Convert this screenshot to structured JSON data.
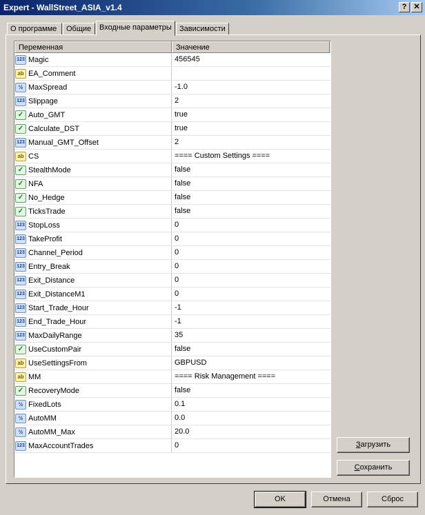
{
  "window": {
    "title": "Expert - WallStreet_ASIA_v1.4",
    "help_glyph": "?",
    "close_glyph": "✕"
  },
  "tabs": [
    {
      "label": "О программе"
    },
    {
      "label": "Общие"
    },
    {
      "label": "Входные параметры"
    },
    {
      "label": "Зависимости"
    }
  ],
  "grid": {
    "headers": {
      "variable": "Переменная",
      "value": "Значение"
    },
    "rows": [
      {
        "type": "int",
        "icon": "int-icon",
        "badge": "123",
        "name": "Magic",
        "value": "456545"
      },
      {
        "type": "str",
        "icon": "string-icon",
        "badge": "ab",
        "name": "EA_Comment",
        "value": ""
      },
      {
        "type": "dbl",
        "icon": "double-icon",
        "badge": "½",
        "name": "MaxSpread",
        "value": "-1.0"
      },
      {
        "type": "int",
        "icon": "int-icon",
        "badge": "123",
        "name": "Slippage",
        "value": "2"
      },
      {
        "type": "bool",
        "icon": "bool-icon",
        "badge": "✓",
        "name": "Auto_GMT",
        "value": "true"
      },
      {
        "type": "bool",
        "icon": "bool-icon",
        "badge": "✓",
        "name": "Calculate_DST",
        "value": "true"
      },
      {
        "type": "int",
        "icon": "int-icon",
        "badge": "123",
        "name": "Manual_GMT_Offset",
        "value": "2"
      },
      {
        "type": "str",
        "icon": "string-icon",
        "badge": "ab",
        "name": "CS",
        "value": "==== Custom Settings ===="
      },
      {
        "type": "bool",
        "icon": "bool-icon",
        "badge": "✓",
        "name": "StealthMode",
        "value": "false"
      },
      {
        "type": "bool",
        "icon": "bool-icon",
        "badge": "✓",
        "name": "NFA",
        "value": "false"
      },
      {
        "type": "bool",
        "icon": "bool-icon",
        "badge": "✓",
        "name": "No_Hedge",
        "value": "false"
      },
      {
        "type": "bool",
        "icon": "bool-icon",
        "badge": "✓",
        "name": "TicksTrade",
        "value": "false"
      },
      {
        "type": "int",
        "icon": "int-icon",
        "badge": "123",
        "name": "StopLoss",
        "value": "0"
      },
      {
        "type": "int",
        "icon": "int-icon",
        "badge": "123",
        "name": "TakeProfit",
        "value": "0"
      },
      {
        "type": "int",
        "icon": "int-icon",
        "badge": "123",
        "name": "Channel_Period",
        "value": "0"
      },
      {
        "type": "int",
        "icon": "int-icon",
        "badge": "123",
        "name": "Entry_Break",
        "value": "0"
      },
      {
        "type": "int",
        "icon": "int-icon",
        "badge": "123",
        "name": "Exit_Distance",
        "value": "0"
      },
      {
        "type": "int",
        "icon": "int-icon",
        "badge": "123",
        "name": "Exit_DistanceM1",
        "value": "0"
      },
      {
        "type": "int",
        "icon": "int-icon",
        "badge": "123",
        "name": "Start_Trade_Hour",
        "value": "-1"
      },
      {
        "type": "int",
        "icon": "int-icon",
        "badge": "123",
        "name": "End_Trade_Hour",
        "value": "-1"
      },
      {
        "type": "int",
        "icon": "int-icon",
        "badge": "123",
        "name": "MaxDailyRange",
        "value": "35"
      },
      {
        "type": "bool",
        "icon": "bool-icon",
        "badge": "✓",
        "name": "UseCustomPair",
        "value": "false"
      },
      {
        "type": "str",
        "icon": "string-icon",
        "badge": "ab",
        "name": "UseSettingsFrom",
        "value": "GBPUSD"
      },
      {
        "type": "str",
        "icon": "string-icon",
        "badge": "ab",
        "name": "MM",
        "value": "==== Risk Management ===="
      },
      {
        "type": "bool",
        "icon": "bool-icon",
        "badge": "✓",
        "name": "RecoveryMode",
        "value": "false"
      },
      {
        "type": "dbl",
        "icon": "double-icon",
        "badge": "½",
        "name": "FixedLots",
        "value": "0.1"
      },
      {
        "type": "dbl",
        "icon": "double-icon",
        "badge": "½",
        "name": "AutoMM",
        "value": "0.0"
      },
      {
        "type": "dbl",
        "icon": "double-icon",
        "badge": "½",
        "name": "AutoMM_Max",
        "value": "20.0"
      },
      {
        "type": "int",
        "icon": "int-icon",
        "badge": "123",
        "name": "MaxAccountTrades",
        "value": "0"
      }
    ]
  },
  "side_buttons": {
    "load": {
      "hotkey": "З",
      "rest": "агрузить"
    },
    "save": {
      "hotkey": "С",
      "rest": "охранить"
    }
  },
  "footer": {
    "ok": "OK",
    "cancel": "Отмена",
    "reset": "Сброс"
  }
}
